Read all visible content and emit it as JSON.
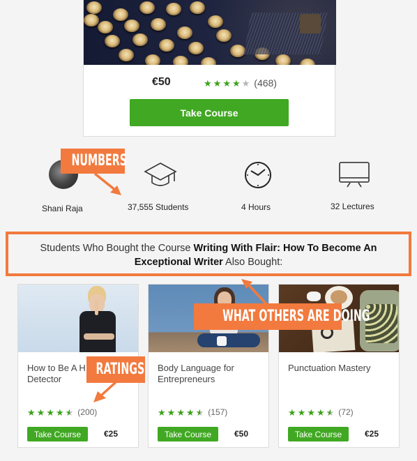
{
  "featured_course": {
    "image": "typewriter-keys-photo",
    "price": "€50",
    "rating": 4,
    "rating_max": 5,
    "rating_count": "(468)",
    "button_label": "Take Course"
  },
  "stats": {
    "instructor": {
      "icon": "avatar",
      "label": "Shani Raja"
    },
    "students": {
      "icon": "graduation-cap-icon",
      "label": "37,555 Students"
    },
    "hours": {
      "icon": "clock-icon",
      "label": "4 Hours"
    },
    "lectures": {
      "icon": "monitor-icon",
      "label": "32 Lectures"
    }
  },
  "also_bought": {
    "prefix": "Students Who Bought the Course ",
    "course_name_line1": "Writing With Flair: How To Become An",
    "course_name_line2": "Exceptional Writer",
    "suffix": " Also Bought:"
  },
  "courses": [
    {
      "title": "How to Be A Human Lie Detector",
      "title_visible": "How to Be A H",
      "title_line2": "Detector",
      "image": "woman-finger-on-lips-photo",
      "rating": 4.5,
      "rating_count": "(200)",
      "button_label": "Take Course",
      "price": "€25"
    },
    {
      "title": "Body Language for Entrepreneurs",
      "title_line1": "Body Language for",
      "title_line2": "Entrepreneurs",
      "image": "woman-sitting-with-mug-photo",
      "rating": 4.5,
      "rating_count": "(157)",
      "button_label": "Take Course",
      "price": "€50"
    },
    {
      "title": "Punctuation Mastery",
      "image": "typewriter-coffee-desk-photo",
      "rating": 4.5,
      "rating_count": "(72)",
      "button_label": "Take Course",
      "price": "€25"
    }
  ],
  "annotations": {
    "numbers": "NUMBERS",
    "ratings": "RATINGS",
    "social": "WHAT OTHERS ARE DOING"
  },
  "colors": {
    "accent_green": "#40a822",
    "star_green": "#3ca21b",
    "annotation_orange": "#f27a3e",
    "background": "#f4f4f4"
  }
}
